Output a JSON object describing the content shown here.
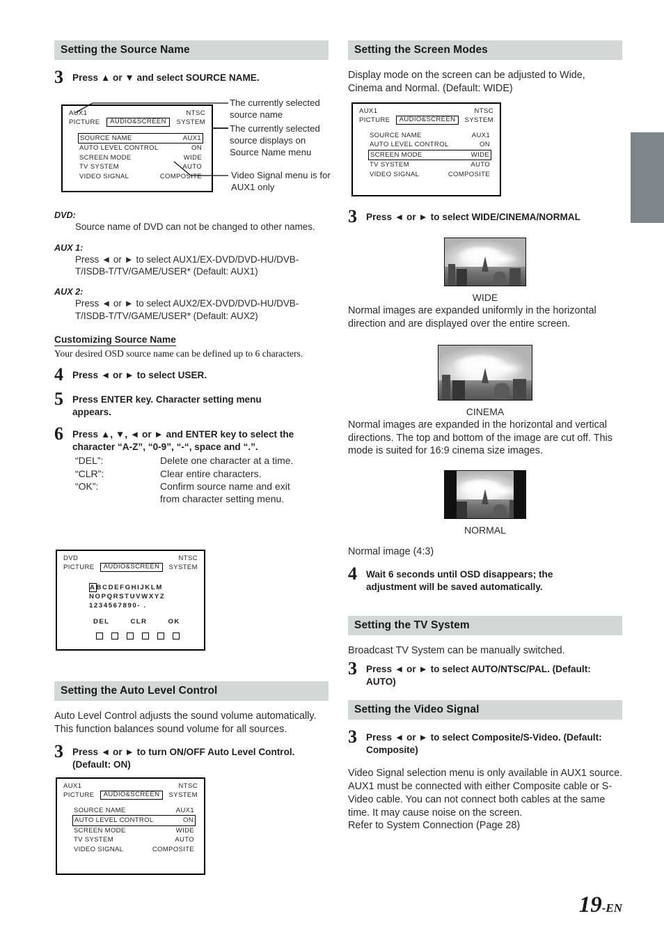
{
  "page": {
    "number": "19",
    "suffix": "-EN"
  },
  "colors": {
    "header_bg": "#d5d6d6",
    "edge_tab": "#7d8588",
    "text": "#231f20"
  },
  "left_column": {
    "source_name": {
      "heading": "Setting the Source Name",
      "step3": {
        "num": "3",
        "text": "Press ▲ or ▼ and select SOURCE NAME."
      },
      "osd": {
        "source": "AUX1",
        "system": "NTSC",
        "tab_left": "PICTURE",
        "tab_selected": "AUDIO&SCREEN",
        "tab_right": "SYSTEM",
        "items": [
          {
            "label": "SOURCE NAME",
            "value": "AUX1",
            "selected": true
          },
          {
            "label": "AUTO LEVEL CONTROL",
            "value": "ON",
            "selected": false
          },
          {
            "label": "SCREEN MODE",
            "value": "WIDE",
            "selected": false
          },
          {
            "label": "TV SYSTEM",
            "value": "AUTO",
            "selected": false
          },
          {
            "label": "VIDEO SIGNAL",
            "value": "COMPOSITE",
            "selected": false
          }
        ]
      },
      "callouts": [
        "The currently selected source name",
        "The currently selected source displays on Source Name menu",
        "Video Signal menu is for AUX1 only"
      ],
      "dvd": {
        "label": "DVD:",
        "text": "Source name of DVD can not be changed to other names."
      },
      "aux1": {
        "label": "AUX 1:",
        "text": "Press ◄ or ► to select AUX1/EX-DVD/DVD-HU/DVB-T/ISDB-T/TV/GAME/USER* (Default: AUX1)"
      },
      "aux2": {
        "label": "AUX 2:",
        "text": "Press ◄ or ► to select AUX2/EX-DVD/DVD-HU/DVB-T/ISDB-T/TV/GAME/USER* (Default: AUX2)"
      },
      "customizing": {
        "heading": "Customizing Source Name",
        "text": "Your desired OSD source name can be defined up to 6 characters.",
        "step4": {
          "num": "4",
          "text": "Press ◄ or ► to select USER."
        },
        "step5": {
          "num": "5",
          "text": "Press ENTER key. Character setting menu appears."
        },
        "step6": {
          "num": "6",
          "text": "Press ▲, ▼, ◄ or ► and ENTER key to select the character “A-Z”, “0-9”, “-“, space and “.”.",
          "definitions": [
            {
              "key": "“DEL”:",
              "value": "Delete one character at a time."
            },
            {
              "key": "“CLR”:",
              "value": "Clear entire characters."
            },
            {
              "key": "“OK”:",
              "value": "Confirm source name and exit",
              "cont": "from character setting menu."
            }
          ]
        }
      },
      "char_osd": {
        "source": "DVD",
        "system": "NTSC",
        "tab_left": "PICTURE",
        "tab_selected": "AUDIO&SCREEN",
        "tab_right": "SYSTEM",
        "row1_highlight": "A",
        "row1_rest": "BCDEFGHIJKLM",
        "row2": "NOPQRSTUVWXYZ",
        "row3": "1234567890-  .",
        "actions": [
          "DEL",
          "CLR",
          "OK"
        ],
        "slot_count": 6
      }
    },
    "auto_level": {
      "heading": "Setting the Auto Level Control",
      "intro": "Auto Level Control adjusts the sound volume automatically. This function balances sound volume for all sources.",
      "step3": {
        "num": "3",
        "text": "Press ◄ or ► to turn ON/OFF Auto Level Control. (Default: ON)"
      },
      "osd": {
        "source": "AUX1",
        "system": "NTSC",
        "tab_left": "PICTURE",
        "tab_selected": "AUDIO&SCREEN",
        "tab_right": "SYSTEM",
        "items": [
          {
            "label": "SOURCE NAME",
            "value": "AUX1",
            "selected": false
          },
          {
            "label": "AUTO LEVEL CONTROL",
            "value": "ON",
            "selected": true
          },
          {
            "label": "SCREEN MODE",
            "value": "WIDE",
            "selected": false
          },
          {
            "label": "TV SYSTEM",
            "value": "AUTO",
            "selected": false
          },
          {
            "label": "VIDEO SIGNAL",
            "value": "COMPOSITE",
            "selected": false
          }
        ]
      }
    }
  },
  "right_column": {
    "screen_modes": {
      "heading": "Setting the Screen Modes",
      "intro": "Display mode on the screen can be adjusted to Wide, Cinema and Normal. (Default: WIDE)",
      "osd": {
        "source": "AUX1",
        "system": "NTSC",
        "tab_left": "PICTURE",
        "tab_selected": "AUDIO&SCREEN",
        "tab_right": "SYSTEM",
        "items": [
          {
            "label": "SOURCE NAME",
            "value": "AUX1",
            "selected": false
          },
          {
            "label": "AUTO LEVEL CONTROL",
            "value": "ON",
            "selected": false
          },
          {
            "label": "SCREEN MODE",
            "value": "WIDE",
            "selected": true
          },
          {
            "label": "TV SYSTEM",
            "value": "AUTO",
            "selected": false
          },
          {
            "label": "VIDEO SIGNAL",
            "value": "COMPOSITE",
            "selected": false
          }
        ]
      },
      "step3": {
        "num": "3",
        "text": "Press ◄ or ► to select WIDE/CINEMA/NORMAL"
      },
      "modes": [
        {
          "caption": "WIDE",
          "description": "Normal images are expanded uniformly in the horizontal direction and are displayed over the entire screen."
        },
        {
          "caption": "CINEMA",
          "description": "Normal images are expanded in the horizontal and vertical directions. The top and bottom of the image are cut off. This mode is suited for 16:9 cinema size images."
        },
        {
          "caption": "NORMAL",
          "description": "Normal image (4:3)"
        }
      ],
      "step4": {
        "num": "4",
        "text": "Wait 6 seconds until OSD disappears; the adjustment will be saved automatically."
      }
    },
    "tv_system": {
      "heading": "Setting the TV System",
      "intro": "Broadcast TV System can be manually switched.",
      "step3": {
        "num": "3",
        "text": "Press ◄ or ► to select AUTO/NTSC/PAL. (Default: AUTO)"
      }
    },
    "video_signal": {
      "heading": "Setting the Video Signal",
      "step3": {
        "num": "3",
        "text": "Press ◄ or ► to select Composite/S-Video. (Default: Composite)"
      },
      "notes": "Video Signal selection menu is only available in AUX1 source.\nAUX1 must be connected with either Composite cable or S-Video cable. You can not connect both cables at the same time. It may cause noise on the screen.\nRefer to System Connection (Page 28)"
    }
  }
}
